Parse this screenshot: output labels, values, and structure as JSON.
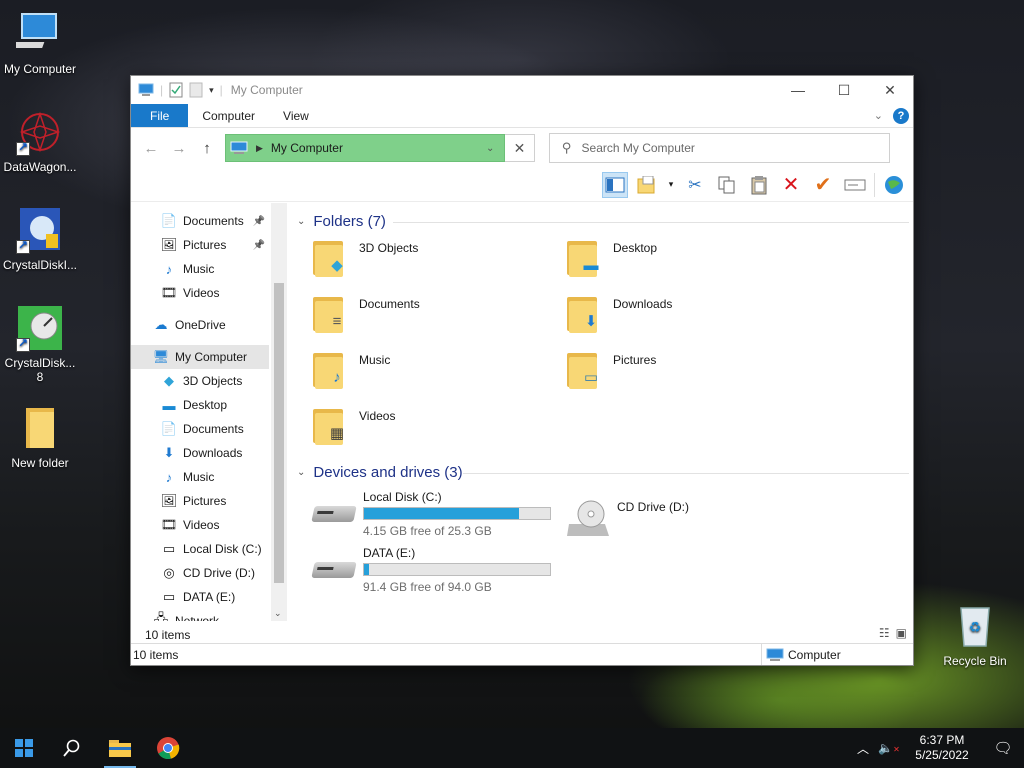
{
  "desktop": {
    "icons": [
      {
        "label": "My Computer"
      },
      {
        "label": "DataWagon..."
      },
      {
        "label": "CrystalDiskI..."
      },
      {
        "label": "CrystalDisk...",
        "label2": "8"
      },
      {
        "label": "New folder"
      },
      {
        "label": "Recycle Bin"
      }
    ]
  },
  "window": {
    "title": "My Computer",
    "controls": {
      "minimize": "—",
      "maximize": "☐",
      "close": "✕"
    },
    "ribbon_tabs": [
      "File",
      "Computer",
      "View"
    ],
    "help": "?",
    "address": {
      "path": "My Computer",
      "clear": "✕"
    },
    "search_placeholder": "Search My Computer",
    "nav_icons": {
      "back": "←",
      "forward": "→",
      "up": "↑"
    },
    "toolbar_icons": [
      "preview-pane-icon",
      "new-folder-icon",
      "dropdown-icon",
      "cut-icon",
      "copy-icon",
      "paste-icon",
      "delete-icon",
      "check-icon",
      "rename-icon",
      "globe-icon"
    ]
  },
  "navpane": {
    "items": [
      {
        "label": "Documents",
        "icon": "📄",
        "pinned": true
      },
      {
        "label": "Pictures",
        "icon": "🖼",
        "pinned": true
      },
      {
        "label": "Music",
        "icon": "♪",
        "pinned": false
      },
      {
        "label": "Videos",
        "icon": "🎞",
        "pinned": false
      },
      {
        "label": "OneDrive",
        "icon": "☁",
        "pinned": false
      },
      {
        "label": "My Computer",
        "icon": "🖥",
        "pinned": false
      },
      {
        "label": "3D Objects",
        "icon": "◆",
        "pinned": false
      },
      {
        "label": "Desktop",
        "icon": "▬",
        "pinned": false
      },
      {
        "label": "Documents",
        "icon": "📄",
        "pinned": false
      },
      {
        "label": "Downloads",
        "icon": "⬇",
        "pinned": false
      },
      {
        "label": "Music",
        "icon": "♪",
        "pinned": false
      },
      {
        "label": "Pictures",
        "icon": "🖼",
        "pinned": false
      },
      {
        "label": "Videos",
        "icon": "🎞",
        "pinned": false
      },
      {
        "label": "Local Disk (C:)",
        "icon": "▭",
        "pinned": false
      },
      {
        "label": "CD Drive (D:)",
        "icon": "◎",
        "pinned": false
      },
      {
        "label": "DATA (E:)",
        "icon": "▭",
        "pinned": false
      },
      {
        "label": "Network",
        "icon": "🖧",
        "pinned": false
      }
    ],
    "selected": "My Computer"
  },
  "folders": {
    "header": "Folders (7)",
    "items": [
      {
        "name": "3D Objects",
        "badge": "◆",
        "badge_color": "#2fa4d8"
      },
      {
        "name": "Desktop",
        "badge": "▬",
        "badge_color": "#1a8ad4"
      },
      {
        "name": "Documents",
        "badge": "≡",
        "badge_color": "#5a5a5a"
      },
      {
        "name": "Downloads",
        "badge": "⬇",
        "badge_color": "#1f7ad0"
      },
      {
        "name": "Music",
        "badge": "♪",
        "badge_color": "#1f7ad0"
      },
      {
        "name": "Pictures",
        "badge": "▭",
        "badge_color": "#3b7fa8"
      },
      {
        "name": "Videos",
        "badge": "▦",
        "badge_color": "#3b3b3b"
      }
    ]
  },
  "drives": {
    "header": "Devices and drives (3)",
    "items": [
      {
        "name": "Local Disk (C:)",
        "free": "4.15 GB free of 25.3 GB",
        "used_fraction": 0.836,
        "type": "hdd"
      },
      {
        "name": "CD Drive (D:)",
        "free": "",
        "used_fraction": null,
        "type": "cd"
      },
      {
        "name": "DATA (E:)",
        "free": "91.4 GB free of 94.0 GB",
        "used_fraction": 0.028,
        "type": "hdd"
      }
    ]
  },
  "status": {
    "items_count": "10 items",
    "statusbar_left": "10 items",
    "statusbar_right": "Computer"
  },
  "taskbar": {
    "time": "6:37 PM",
    "date": "5/25/2022"
  }
}
